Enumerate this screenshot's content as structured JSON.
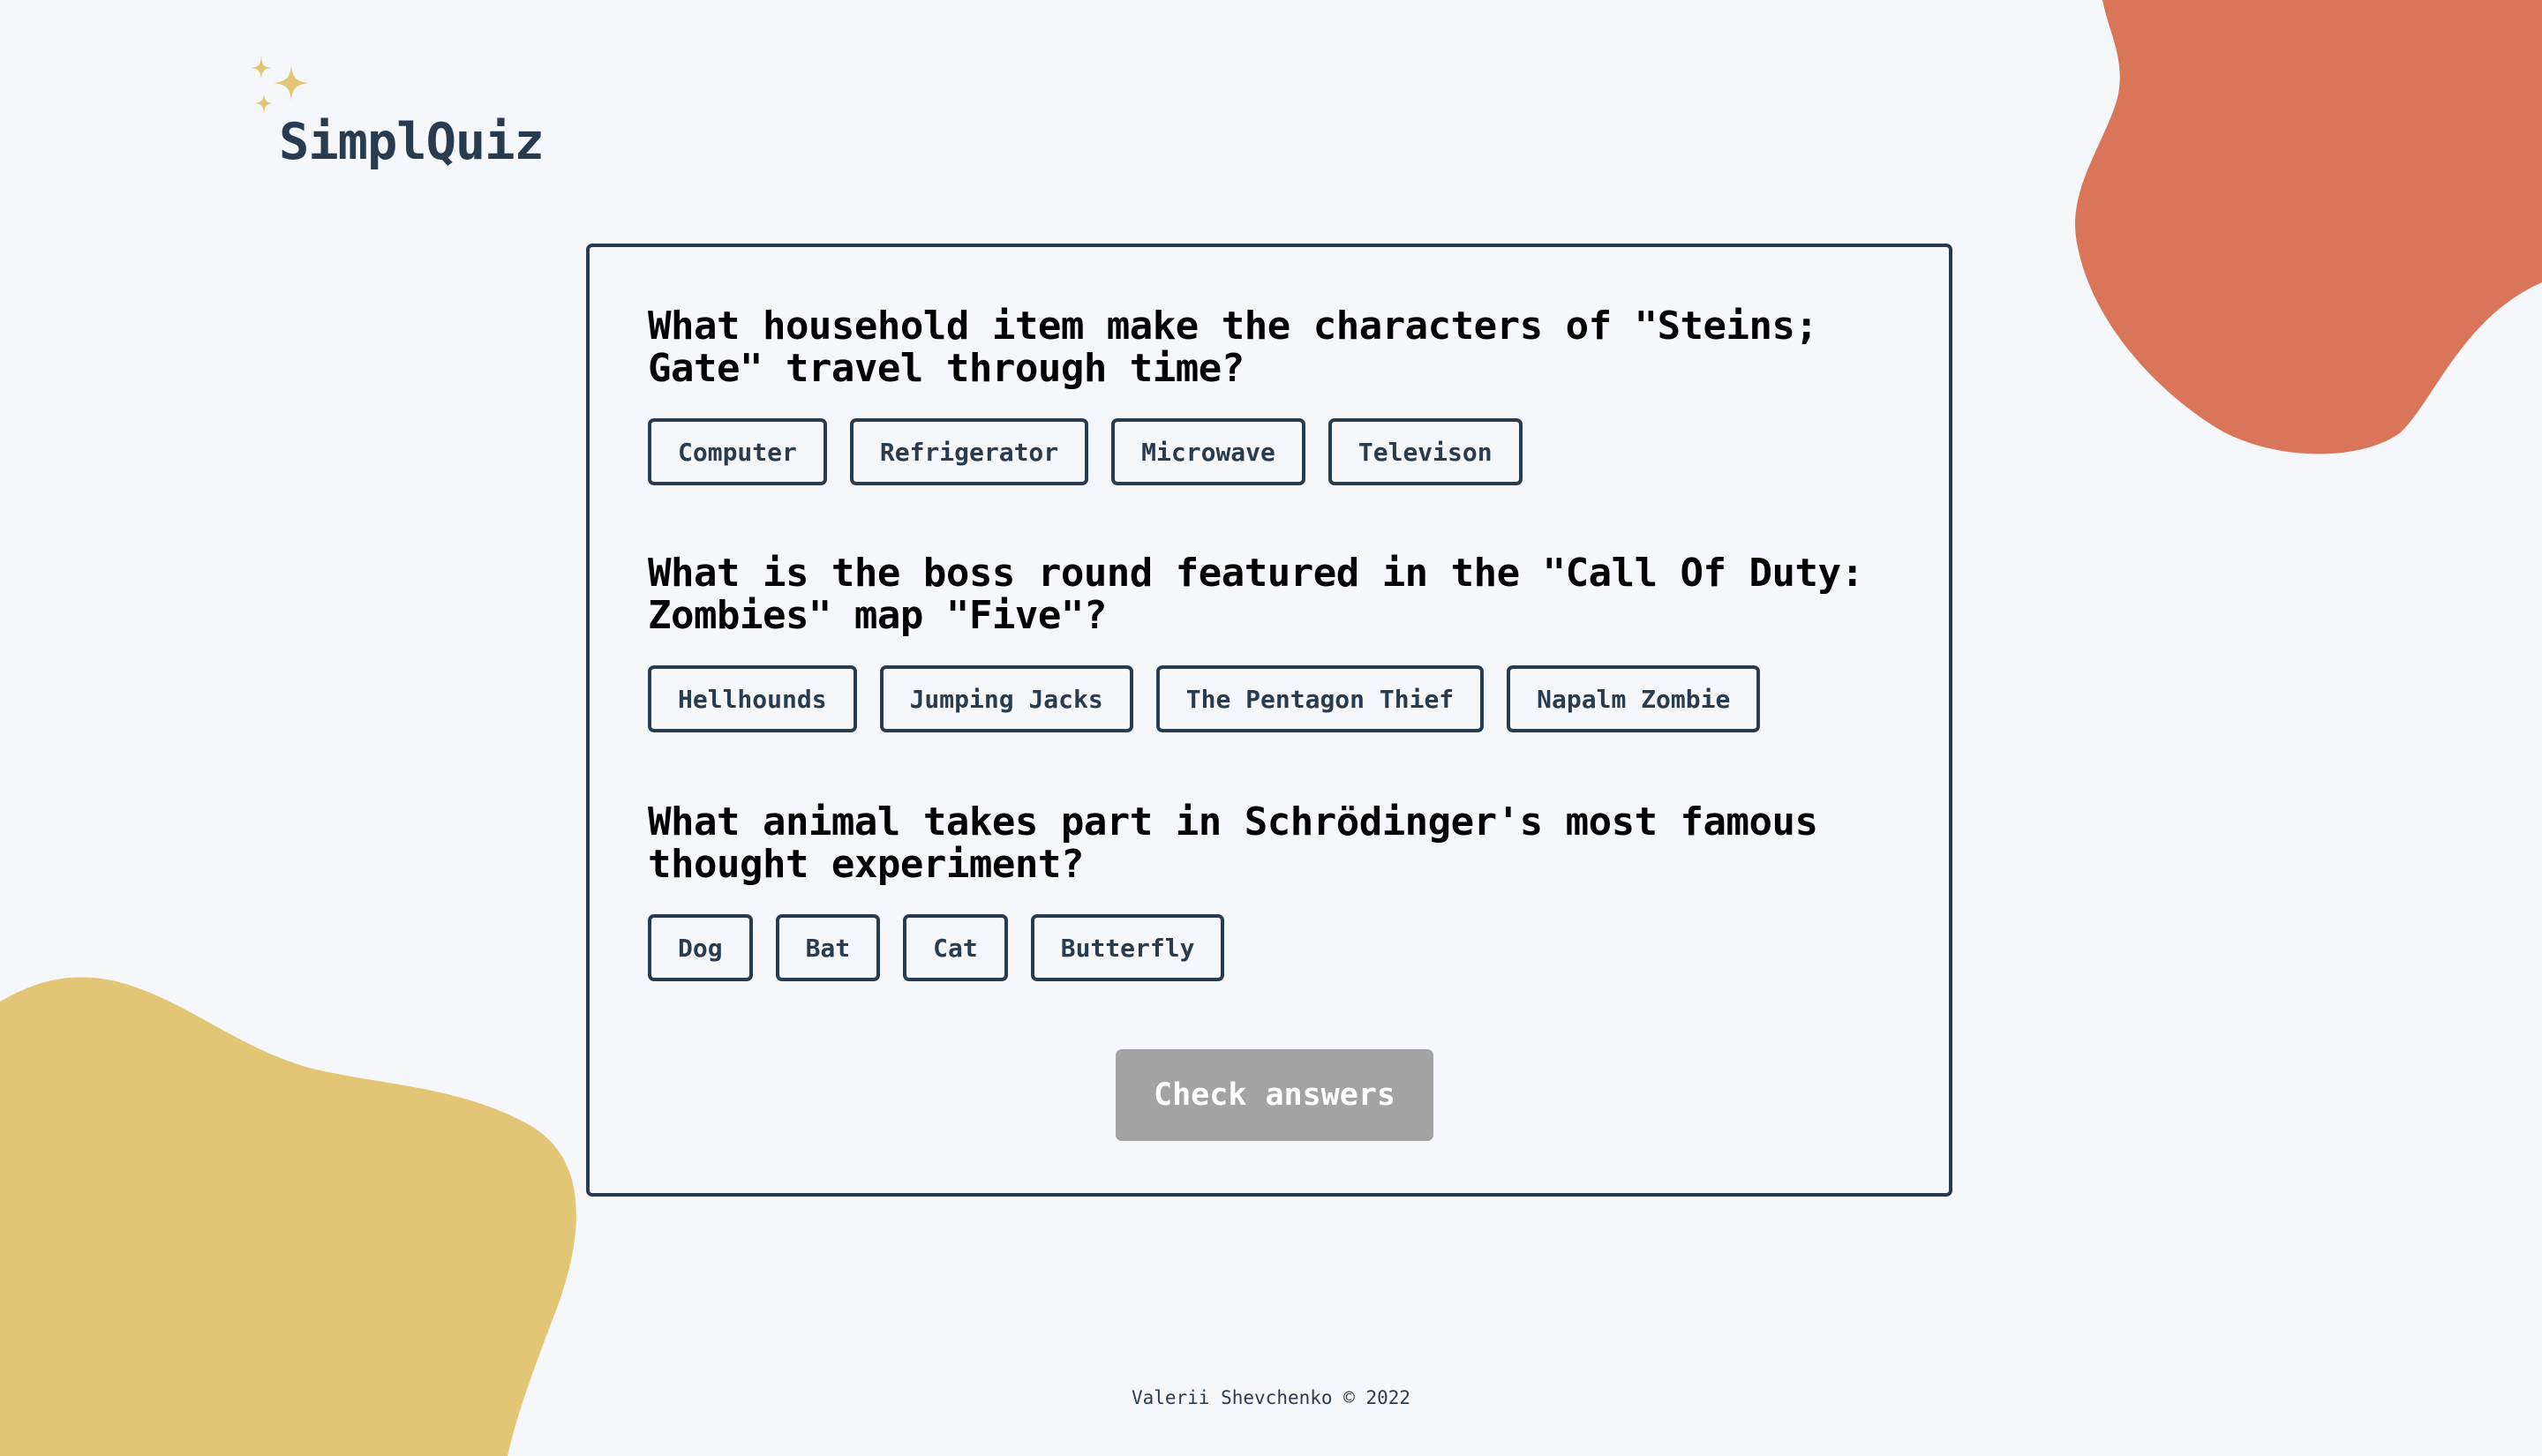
{
  "app": {
    "logo_text": "SimplQuiz"
  },
  "colors": {
    "background": "#f5f7fb",
    "primary_text": "#293c4f",
    "question_text": "#000000",
    "button_disabled": "#a3a3a3",
    "blob_orange": "#d9765a",
    "blob_yellow": "#e2c575",
    "sparkle": "#e2c575"
  },
  "icons": {
    "logo": "sparkles-icon"
  },
  "questions": [
    {
      "text": "What household item make the characters of \"Steins; Gate\" travel through time?",
      "answers": [
        "Computer",
        "Refrigerator",
        "Microwave",
        "Televison"
      ]
    },
    {
      "text": "What is the boss round featured in the \"Call Of Duty: Zombies\" map \"Five\"?",
      "answers": [
        "Hellhounds",
        "Jumping Jacks",
        "The Pentagon Thief",
        "Napalm Zombie"
      ]
    },
    {
      "text": "What animal takes part in Schrödinger's most famous thought experiment?",
      "answers": [
        "Dog",
        "Bat",
        "Cat",
        "Butterfly"
      ]
    }
  ],
  "check_button": {
    "label": "Check answers",
    "state": "disabled"
  },
  "footer": {
    "text": "Valerii Shevchenko © 2022"
  }
}
